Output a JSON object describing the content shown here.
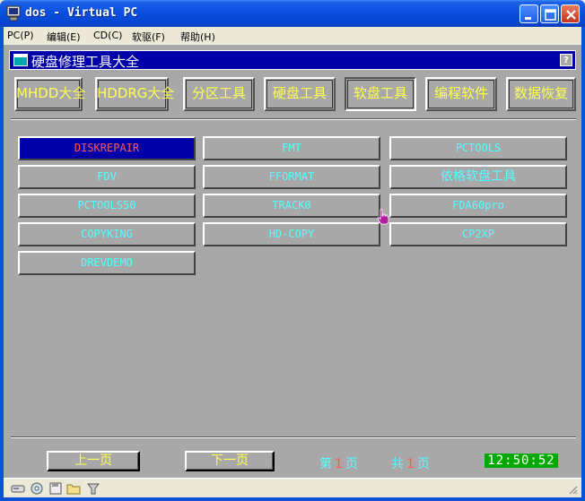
{
  "window": {
    "title": "dos - Virtual PC"
  },
  "menu": [
    {
      "label": "PC(P)"
    },
    {
      "label": "编辑(E)"
    },
    {
      "label": "CD(C)"
    },
    {
      "label": "软驱(F)"
    },
    {
      "label": "帮助(H)"
    }
  ],
  "header": {
    "title": "硬盘修理工具大全",
    "help_label": "?"
  },
  "categories": [
    {
      "label": "MHDD大全"
    },
    {
      "label": "HDDRG大全"
    },
    {
      "label": "分区工具"
    },
    {
      "label": "硬盘工具"
    },
    {
      "label": "软盘工具",
      "active": true
    },
    {
      "label": "编程软件"
    },
    {
      "label": "数据恢复"
    }
  ],
  "tools": [
    {
      "label": "DISKREPAIR",
      "selected": true
    },
    {
      "label": "FMT"
    },
    {
      "label": "PCTOOLS"
    },
    {
      "label": "FDV"
    },
    {
      "label": "FFORMAT"
    },
    {
      "label": "依格软盘工具"
    },
    {
      "label": "PCTOOLS50"
    },
    {
      "label": "TRACK0"
    },
    {
      "label": "FDA60pro"
    },
    {
      "label": "COPYKING"
    },
    {
      "label": "HD-COPY"
    },
    {
      "label": "CP2XP"
    },
    {
      "label": "DREVDEMO"
    }
  ],
  "footer": {
    "prev_label": "上一页",
    "next_label": "下一页",
    "page_prefix": "第",
    "page_current": "1",
    "page_suffix": "页",
    "total_prefix": "共",
    "page_total": "1",
    "total_suffix": "页",
    "clock": "12:50:52"
  },
  "colors": {
    "dos_bg": "#a8a8a8",
    "header_bg": "#0000a8",
    "category_text": "#ffff55",
    "tool_text": "#55ffff",
    "selected_text": "#ff5555",
    "clock_bg": "#00a800"
  }
}
